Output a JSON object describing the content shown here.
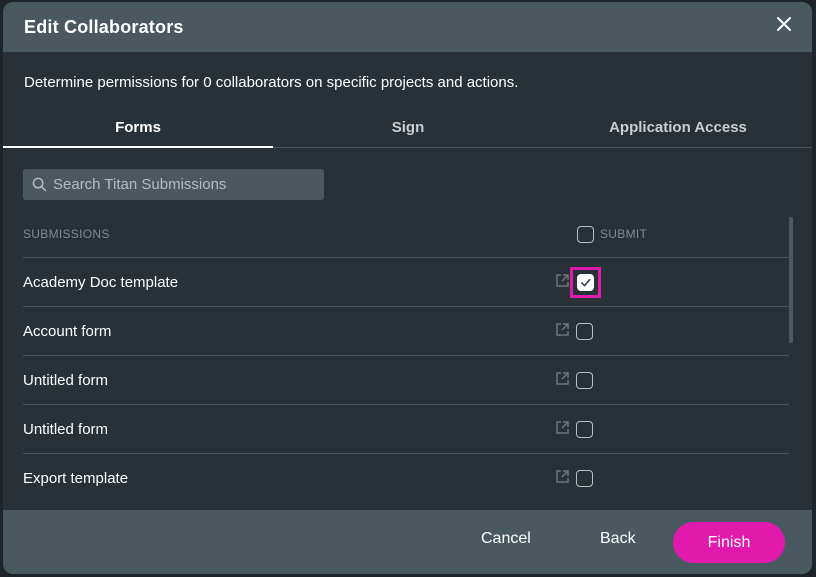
{
  "dialog": {
    "title": "Edit Collaborators",
    "close_icon": "close-icon",
    "description": "Determine permissions for 0 collaborators on specific projects and actions."
  },
  "tabs": [
    {
      "label": "Forms",
      "active": true
    },
    {
      "label": "Sign",
      "active": false
    },
    {
      "label": "Application Access",
      "active": false
    }
  ],
  "search": {
    "placeholder": "Search Titan Submissions",
    "value": "",
    "icon": "search-icon"
  },
  "table": {
    "column_submissions": "SUBMISSIONS",
    "column_submit": "SUBMIT",
    "submit_all_checked": false,
    "rows": [
      {
        "name": "Academy Doc template",
        "submit_checked": true,
        "focused": true
      },
      {
        "name": "Account form",
        "submit_checked": false,
        "focused": false
      },
      {
        "name": "Untitled form",
        "submit_checked": false,
        "focused": false
      },
      {
        "name": "Untitled form",
        "submit_checked": false,
        "focused": false
      },
      {
        "name": "Export template",
        "submit_checked": false,
        "focused": false
      }
    ]
  },
  "footer": {
    "cancel_label": "Cancel",
    "back_label": "Back",
    "finish_label": "Finish"
  },
  "colors": {
    "accent": "#e11aad",
    "header_bg": "#4a5860",
    "body_bg": "#283137"
  }
}
